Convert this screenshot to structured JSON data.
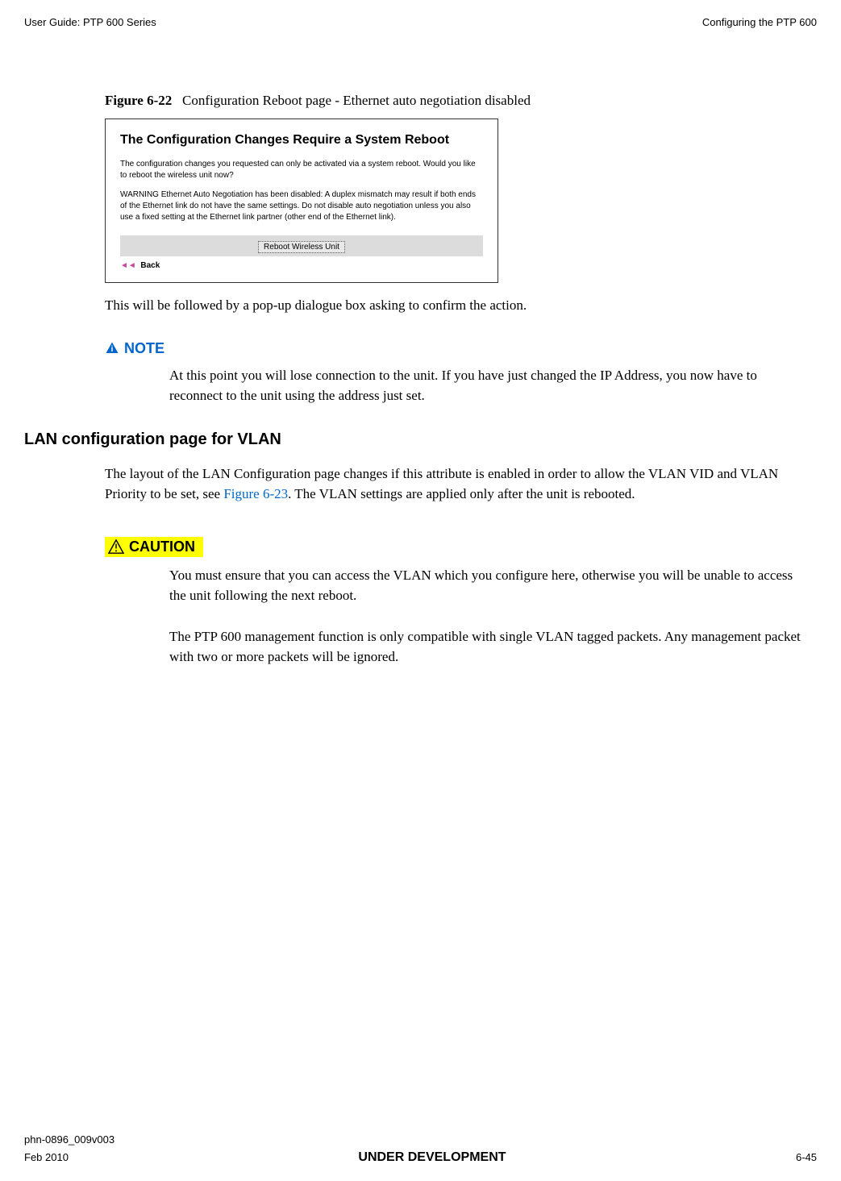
{
  "header": {
    "left": "User Guide: PTP 600 Series",
    "right": "Configuring the PTP 600"
  },
  "figure": {
    "number": "Figure 6-22",
    "caption": "Configuration Reboot page - Ethernet auto negotiation disabled"
  },
  "dialog": {
    "title": "The Configuration Changes Require a System Reboot",
    "para1": "The configuration changes you requested can only be activated via a system reboot. Would you like to reboot the wireless unit now?",
    "para2": "WARNING Ethernet Auto Negotiation has been disabled: A duplex mismatch may result if both ends of the Ethernet link do not have the same settings. Do not disable auto negotiation unless you also use a fixed setting at the Ethernet link partner (other end of the Ethernet link).",
    "button": "Reboot Wireless Unit",
    "back": "Back"
  },
  "body": {
    "after_figure": "This will be followed by a pop-up dialogue box asking to confirm the action.",
    "note_label": "NOTE",
    "note_text": "At this point you will lose connection to the unit. If you have just changed the IP Address, you now have to reconnect to the unit using the address just set.",
    "section_heading": "LAN configuration page for VLAN",
    "vlan_para_before": "The layout of the LAN Configuration page changes if this attribute is enabled in order to allow the VLAN VID and VLAN Priority to be set, see ",
    "vlan_link": "Figure 6-23",
    "vlan_para_after": ". The VLAN settings are applied only after the unit is rebooted.",
    "caution_label": "CAUTION",
    "caution_text1": "You must ensure that you can access the VLAN which you configure here, otherwise you will be unable to access the unit following the next reboot.",
    "caution_text2": "The PTP 600 management function is only compatible with single VLAN tagged packets. Any management packet with two or more packets will be ignored."
  },
  "footer": {
    "doc_number": "phn-0896_009v003",
    "date": "Feb 2010",
    "status": "UNDER DEVELOPMENT",
    "page": "6-45"
  }
}
